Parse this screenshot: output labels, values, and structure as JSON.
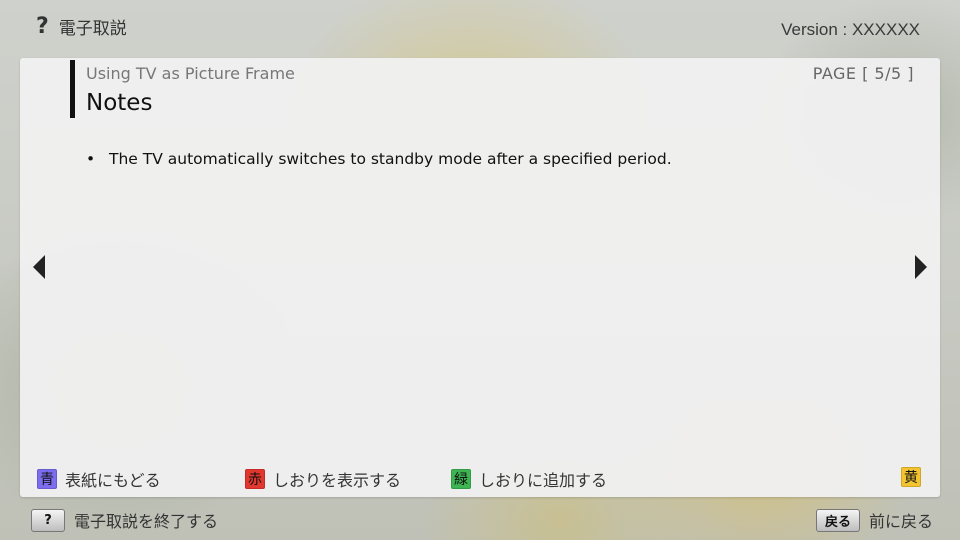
{
  "top_bar": {
    "help_glyph": "?",
    "title": "電子取説",
    "version": "Version : XXXXXX"
  },
  "panel": {
    "breadcrumb": "Using TV as Picture Frame",
    "page_indicator": "PAGE [ 5/5 ]",
    "heading": "Notes",
    "bullets": [
      "The TV automatically switches to standby mode after a specified period."
    ],
    "bullet_glyph": "•"
  },
  "color_keys": [
    {
      "badge": "青",
      "label": "表紙にもどる",
      "color": "#7b6cf0"
    },
    {
      "badge": "赤",
      "label": "しおりを表示する",
      "color": "#e2372e"
    },
    {
      "badge": "緑",
      "label": "しおりに追加する",
      "color": "#3eb553"
    },
    {
      "badge": "黄",
      "label": "",
      "color": "#f2c430"
    }
  ],
  "bottom_bar": {
    "exit_key": "?",
    "exit_label": "電子取説を終了する",
    "back_key": "戻る",
    "back_label": "前に戻る"
  }
}
